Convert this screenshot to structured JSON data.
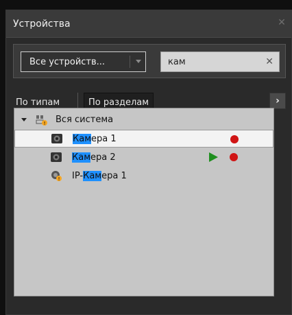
{
  "window": {
    "title": "Устройства",
    "close_icon": "close-icon"
  },
  "filter": {
    "dropdown_value": "Все устройств...",
    "search_value": "кам"
  },
  "tabs": {
    "by_type": "По типам",
    "by_section": "По разделам"
  },
  "tree": {
    "root_label": "Вся система",
    "items": [
      {
        "prefix": "",
        "highlight": "Кам",
        "suffix": "ера 1",
        "recording": true,
        "playing": false,
        "selected": true
      },
      {
        "prefix": "",
        "highlight": "Кам",
        "suffix": "ера 2",
        "recording": true,
        "playing": true,
        "selected": false
      },
      {
        "prefix": "IP-",
        "highlight": "Кам",
        "suffix": "ера 1",
        "recording": false,
        "playing": false,
        "selected": false
      }
    ]
  },
  "colors": {
    "highlight": "#1e90ff",
    "record": "#d01515",
    "play": "#1f8f1f"
  }
}
